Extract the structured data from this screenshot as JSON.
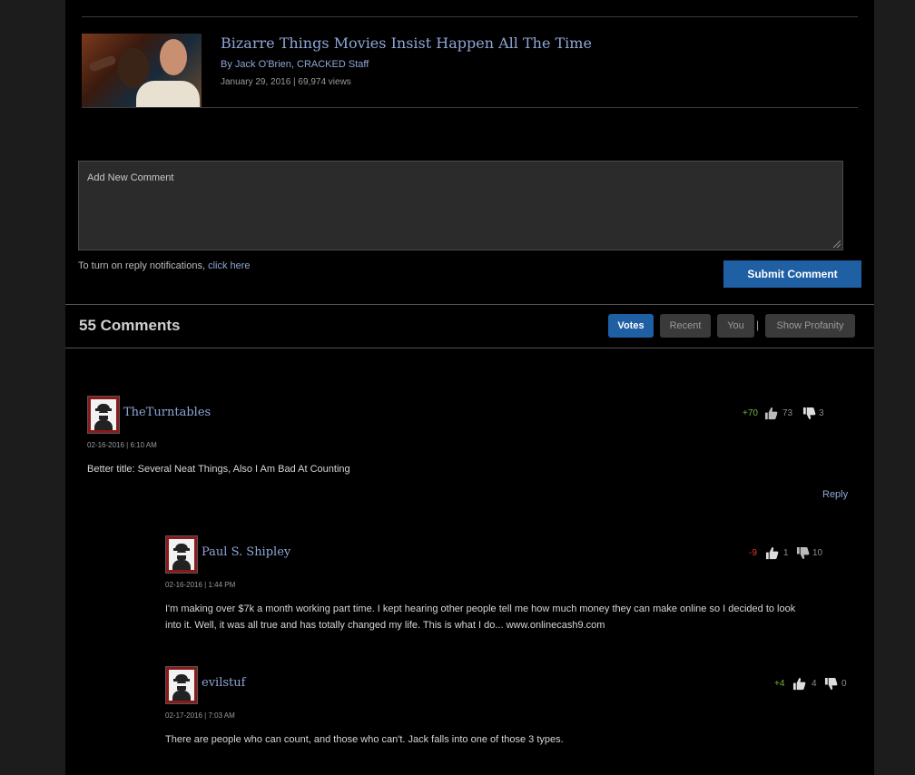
{
  "article": {
    "title": "Bizarre Things Movies Insist Happen All The Time",
    "byline": "By Jack O'Brien, CRACKED Staff",
    "meta": "January 29, 2016 | 69,974 views"
  },
  "composer": {
    "placeholder": "Add New Comment",
    "notify_text": "To turn on reply notifications, ",
    "notify_link": "click here",
    "submit_label": "Submit Comment"
  },
  "comments_header": {
    "count_label": "55 Comments",
    "sort_options": [
      "Votes",
      "Recent",
      "You",
      "Show Profanity"
    ],
    "active_sort": "Votes",
    "separator": "|"
  },
  "comments": [
    {
      "username": "TheTurntables",
      "date": "02-16-2016 | 6:10 AM",
      "text": "Better title: Several Neat Things, Also I Am Bad At Counting",
      "score": "+70",
      "up": "73",
      "down": "3",
      "reply_label": "Reply"
    },
    {
      "username": "Paul S. Shipley",
      "date": "02-16-2016 | 1:44 PM",
      "text_line1": "I'm making over $7k a month working part time. I kept hearing other people tell me how much money they can make online so I decided to look",
      "text_line2": "into it. Well, it was all true and has totally changed my life. This is what I do... www.onlinecash9.com",
      "score": "-9",
      "up": "1",
      "down": "10"
    },
    {
      "username": "evilstuf",
      "date": "02-17-2016 | 7:03 AM",
      "text": "There are people who can count, and those who can't. Jack falls into one of those 3 types.",
      "score": "+4",
      "up": "4",
      "down": "0"
    }
  ],
  "colors": {
    "accent_blue": "#1f5fa3",
    "link_blue": "#8ea6d6",
    "score_positive": "#6fb43a",
    "score_negative": "#e03a2a"
  },
  "icons": [
    "thumbs-up-icon",
    "thumbs-down-icon",
    "resize-grip-icon"
  ]
}
